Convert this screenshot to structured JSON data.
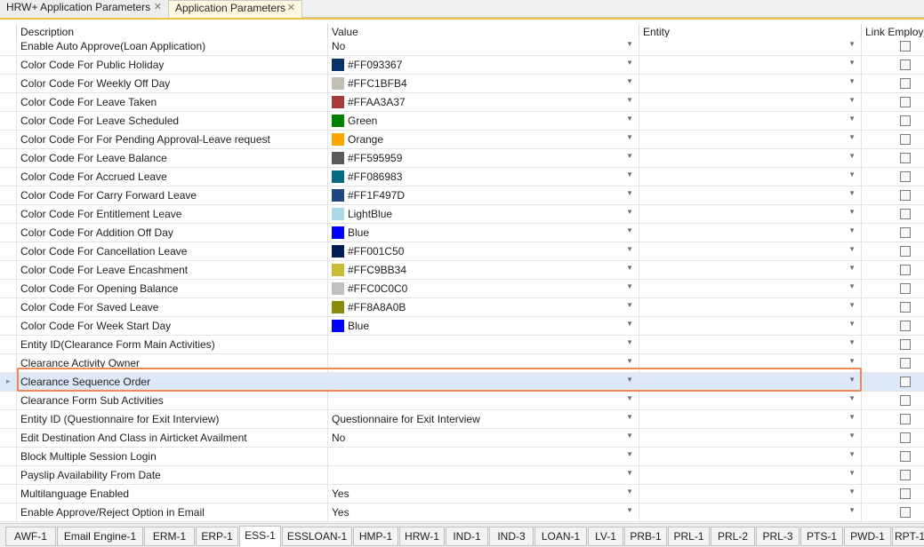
{
  "doc_tabs": [
    {
      "label": "HRW+ Application Parameters",
      "close": "✕",
      "active": false
    },
    {
      "label": "Application Parameters",
      "close": "✕",
      "active": true
    }
  ],
  "grid": {
    "columns": [
      "Description",
      "Value",
      "Entity",
      "Link Employe"
    ],
    "rows": [
      {
        "desc": "Enable Auto Approve(Loan Application)",
        "value": "No",
        "swatch": null
      },
      {
        "desc": "Color Code For Public Holiday",
        "value": "#FF093367",
        "swatch": "#093367"
      },
      {
        "desc": "Color Code For Weekly Off Day",
        "value": "#FFC1BFB4",
        "swatch": "#C1BFB4"
      },
      {
        "desc": "Color Code For Leave Taken",
        "value": "#FFAA3A37",
        "swatch": "#AA3A37"
      },
      {
        "desc": "Color Code For Leave Scheduled",
        "value": "Green",
        "swatch": "#008000"
      },
      {
        "desc": "Color Code For For Pending Approval-Leave request",
        "value": "Orange",
        "swatch": "#FFA500"
      },
      {
        "desc": "Color Code For Leave Balance",
        "value": "#FF595959",
        "swatch": "#595959"
      },
      {
        "desc": "Color Code For Accrued Leave",
        "value": "#FF086983",
        "swatch": "#086983"
      },
      {
        "desc": "Color Code For Carry Forward Leave",
        "value": "#FF1F497D",
        "swatch": "#1F497D"
      },
      {
        "desc": "Color Code For Entitlement Leave",
        "value": "LightBlue",
        "swatch": "#ADD8E6"
      },
      {
        "desc": "Color Code For Addition Off Day",
        "value": "Blue",
        "swatch": "#0000FF"
      },
      {
        "desc": "Color Code For Cancellation Leave",
        "value": "#FF001C50",
        "swatch": "#001C50"
      },
      {
        "desc": "Color Code For Leave Encashment",
        "value": "#FFC9BB34",
        "swatch": "#C9BB34"
      },
      {
        "desc": "Color Code For Opening Balance",
        "value": "#FFC0C0C0",
        "swatch": "#C0C0C0"
      },
      {
        "desc": "Color Code For Saved Leave",
        "value": "#FF8A8A0B",
        "swatch": "#8A8A0B"
      },
      {
        "desc": "Color Code For Week Start Day",
        "value": "Blue",
        "swatch": "#0000FF"
      },
      {
        "desc": "Entity ID(Clearance Form Main Activities)",
        "value": "",
        "swatch": null
      },
      {
        "desc": "Clearance Activity Owner",
        "value": "",
        "swatch": null
      },
      {
        "desc": "Clearance Sequence Order",
        "value": "",
        "swatch": null,
        "selected": true
      },
      {
        "desc": "Clearance Form Sub Activities",
        "value": "",
        "swatch": null
      },
      {
        "desc": "Entity ID (Questionnaire for Exit Interview)",
        "value": "Questionnaire for Exit Interview",
        "swatch": null
      },
      {
        "desc": "Edit Destination And Class in Airticket Availment",
        "value": "No",
        "swatch": null
      },
      {
        "desc": "Block Multiple Session Login",
        "value": "",
        "swatch": null
      },
      {
        "desc": "Payslip Availability From Date",
        "value": "",
        "swatch": null
      },
      {
        "desc": "Multilanguage Enabled",
        "value": "Yes",
        "swatch": null
      },
      {
        "desc": "Enable Approve/Reject Option in Email",
        "value": "Yes",
        "swatch": null
      }
    ],
    "dropdown_glyph": "▼",
    "row_indicator": "▸"
  },
  "bottom_tabs": [
    "AWF-1",
    "Email Engine-1",
    "ERM-1",
    "ERP-1",
    "ESS-1",
    "ESSLOAN-1",
    "HMP-1",
    "HRW-1",
    "IND-1",
    "IND-3",
    "LOAN-1",
    "LV-1",
    "PRB-1",
    "PRL-1",
    "PRL-2",
    "PRL-3",
    "PTS-1",
    "PWD-1",
    "RPT-1"
  ],
  "active_bottom_tab": "ESS-1"
}
